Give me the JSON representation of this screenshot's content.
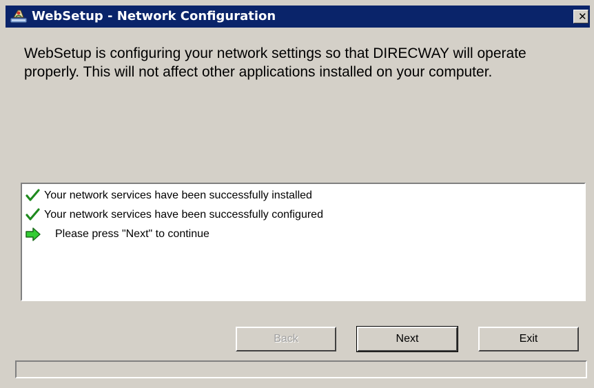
{
  "window": {
    "title": "WebSetup - Network Configuration",
    "close_glyph": "✕"
  },
  "intro": {
    "text": "WebSetup is configuring your network settings so that DIRECWAY will operate properly. This will not affect other applications installed on your computer."
  },
  "status": {
    "items": [
      {
        "icon": "checkmark-icon",
        "text": "Your network services have been successfully installed"
      },
      {
        "icon": "checkmark-icon",
        "text": "Your network services have been successfully configured"
      },
      {
        "icon": "arrow-right-icon",
        "text": "Please press \"Next\" to continue"
      }
    ]
  },
  "buttons": {
    "back": "Back",
    "next": "Next",
    "exit": "Exit"
  },
  "progress": {
    "fraction": 0
  },
  "colors": {
    "titlebar": "#0a246a",
    "dialog": "#d4d0c8",
    "check": "#1f8a1f",
    "arrow": "#33cc33"
  }
}
